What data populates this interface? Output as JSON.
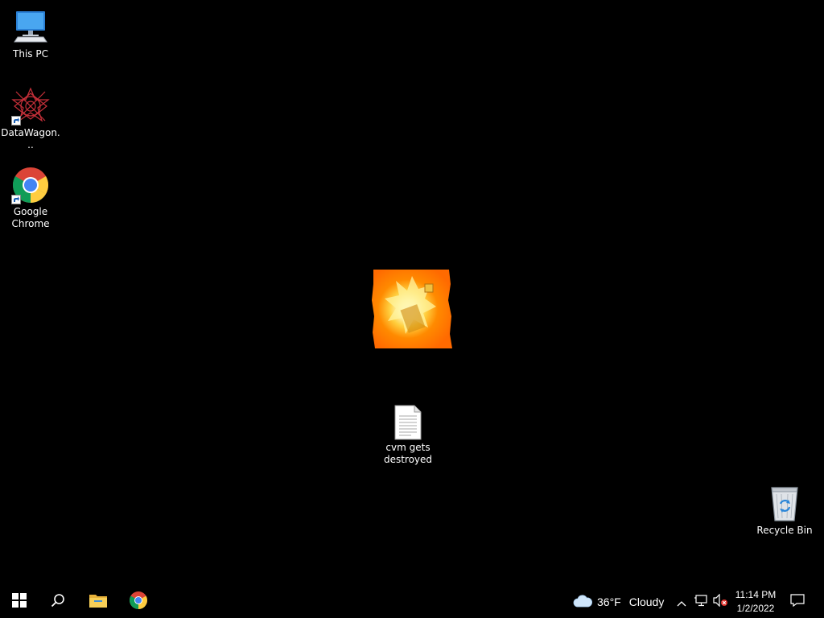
{
  "desktop": {
    "icons": [
      {
        "label": "This PC",
        "icon": "computer-icon"
      },
      {
        "label": "DataWagon...",
        "icon": "datawagon-icon"
      },
      {
        "label": "Google Chrome",
        "icon": "chrome-icon"
      },
      {
        "label": "cvm gets destroyed",
        "icon": "text-file-icon"
      },
      {
        "label": "Recycle Bin",
        "icon": "recycle-bin-icon"
      }
    ],
    "background_color": "#000000"
  },
  "taskbar": {
    "start": {
      "icon": "windows-logo-icon"
    },
    "search": {
      "icon": "search-icon"
    },
    "pinned": [
      {
        "name": "File Explorer",
        "icon": "folder-icon"
      },
      {
        "name": "Google Chrome",
        "icon": "chrome-icon"
      }
    ],
    "weather": {
      "temp": "36°F",
      "condition": "Cloudy",
      "icon": "cloud-icon"
    },
    "tray": [
      {
        "icon": "chevron-up-icon"
      },
      {
        "icon": "network-icon"
      },
      {
        "icon": "speaker-muted-icon"
      }
    ],
    "clock": {
      "time": "11:14 PM",
      "date": "1/2/2022"
    },
    "notifications": {
      "icon": "notification-icon"
    }
  }
}
